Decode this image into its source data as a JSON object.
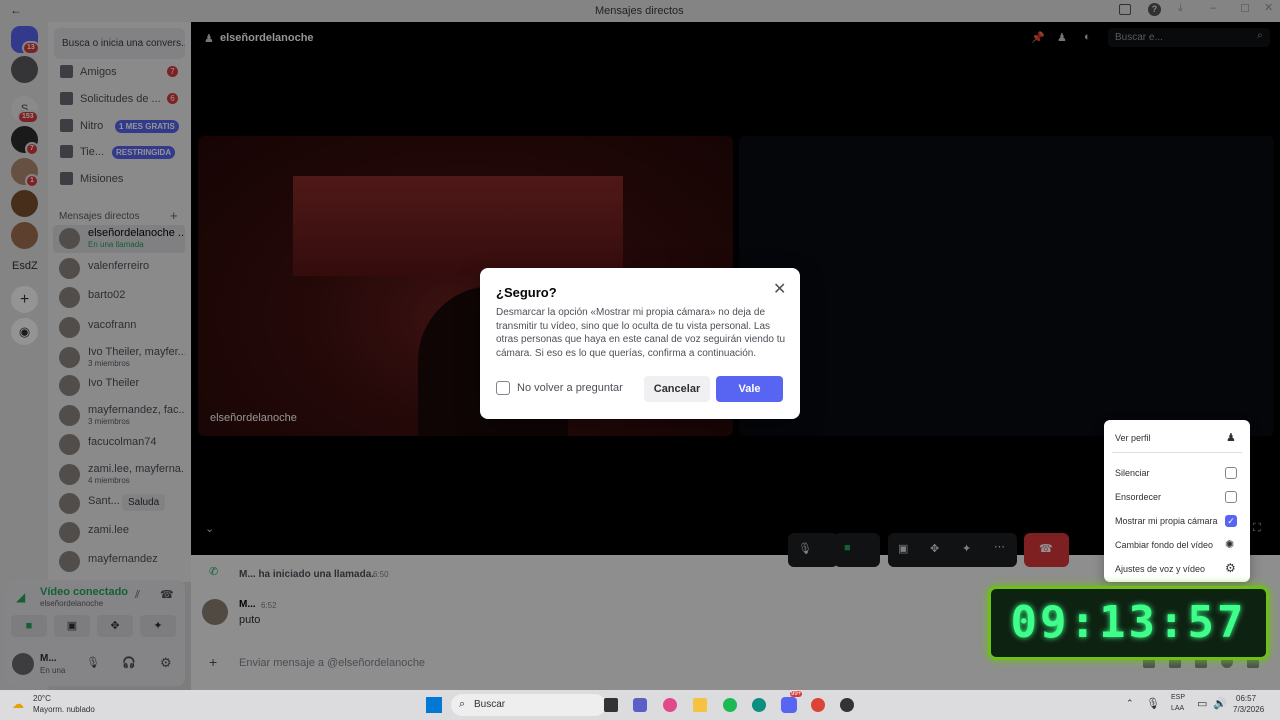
{
  "window": {
    "title": "Mensajes directos"
  },
  "servers": [
    {
      "badge": "13"
    },
    {
      "badge": "153"
    },
    {
      "badge": "7"
    },
    {
      "badge": "1"
    },
    {
      "label": "EsdZ"
    }
  ],
  "dm_search": {
    "placeholder": "Busca o inicia una convers..."
  },
  "nav": [
    {
      "label": "Amigos",
      "count": "7"
    },
    {
      "label": "Solicitudes de ...",
      "count": "6"
    },
    {
      "label": "Nitro",
      "pill": "1 MES GRATIS"
    },
    {
      "label": "Tie...",
      "pill": "RESTRINGIDA"
    },
    {
      "label": "Misiones"
    }
  ],
  "dm_header": "Mensajes directos",
  "dms": [
    {
      "name": "elseñordelanoche ...",
      "sub": "En una llamada"
    },
    {
      "name": "valenferreiro"
    },
    {
      "name": "barto02"
    },
    {
      "name": "vacofrann"
    },
    {
      "name": "Ivo Theiler, mayfer...",
      "sub": "3 miembros"
    },
    {
      "name": "Ivo Theiler"
    },
    {
      "name": "mayfernandez, fac...",
      "sub": "3 miembros"
    },
    {
      "name": "facucolman74"
    },
    {
      "name": "zami.lee, mayferna...",
      "sub": "4 miembros"
    },
    {
      "name": "Sant...",
      "action": "Saluda"
    },
    {
      "name": "zami.lee"
    },
    {
      "name": "mayfernandez"
    }
  ],
  "voice": {
    "status": "Vídeo conectado",
    "channel": "elseñordelanoche"
  },
  "user": {
    "name": "M...",
    "status": "En una"
  },
  "header": {
    "channel": "elseñordelanoche",
    "search": "Buscar e..."
  },
  "tiles": [
    {
      "label": "elseñordelanoche"
    }
  ],
  "messages": [
    {
      "system": "M... ha iniciado una llamada.",
      "time": "6:50"
    },
    {
      "author": "M...",
      "time": "6:52",
      "text": "puto"
    }
  ],
  "composer": {
    "placeholder": "Enviar mensaje a @elseñordelanoche"
  },
  "modal": {
    "title": "¿Seguro?",
    "body": "Desmarcar la opción «Mostrar mi propia cámara» no deja de transmitir tu vídeo, sino que lo oculta de tu vista personal. Las otras personas que haya en este canal de voz seguirán viendo tu cámara. Si eso es lo que querías, confirma a continuación.",
    "checkbox": "No volver a preguntar",
    "cancel": "Cancelar",
    "confirm": "Vale"
  },
  "context_menu": [
    {
      "label": "Ver perfil"
    },
    {
      "label": "Silenciar",
      "checked": false
    },
    {
      "label": "Ensordecer",
      "checked": false
    },
    {
      "label": "Mostrar mi propia cámara",
      "checked": true
    },
    {
      "label": "Cambiar fondo del vídeo"
    },
    {
      "label": "Ajustes de voz y vídeo"
    }
  ],
  "overlay_clock": "09:13:57",
  "taskbar": {
    "temp": "20°C",
    "weather": "Mayorm. nublado",
    "search": "Buscar",
    "lang1": "ESP",
    "lang2": "LAA",
    "time": "06:57",
    "date": "7/3/2026",
    "notif": "99+"
  }
}
